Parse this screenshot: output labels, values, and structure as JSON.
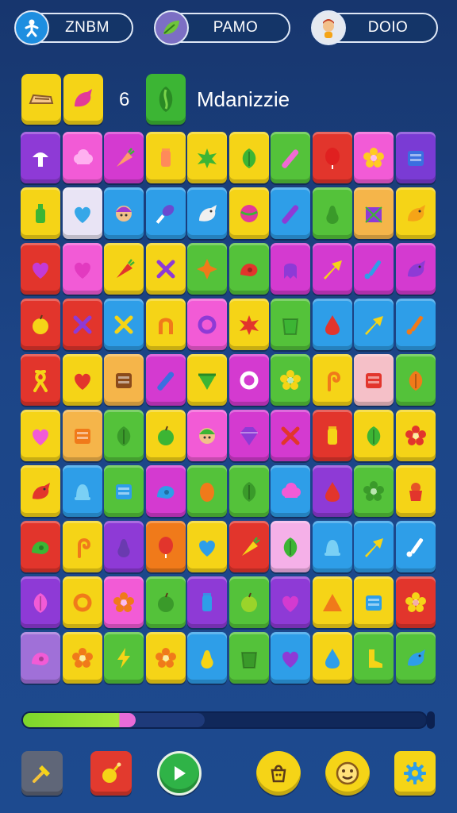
{
  "status_bar": {
    "stat1": {
      "value": "ZNBM",
      "icon": "running-figure-icon"
    },
    "stat2": {
      "value": "PAMO",
      "icon": "leaf-icon"
    },
    "stat3": {
      "value": "DOIO",
      "icon": "avatar-icon"
    }
  },
  "header": {
    "goals": [
      {
        "icon": "shoe-icon",
        "color": "#f5d417"
      },
      {
        "icon": "bird-icon",
        "color": "#f5d417"
      },
      {
        "icon": "leaf-icon",
        "color": "#3cb534"
      }
    ],
    "goal_count": "6",
    "level_title": "Mdanizzie"
  },
  "board": {
    "rows": [
      [
        {
          "c": "#8e3ad6",
          "g": "mushroom",
          "f": "#ffffff"
        },
        {
          "c": "#f25bd6",
          "g": "cloud",
          "f": "#ffb0f0"
        },
        {
          "c": "#d43ad0",
          "g": "carrot",
          "f": "#ff9b6a"
        },
        {
          "c": "#f5d417",
          "g": "jar",
          "f": "#ff8a5a"
        },
        {
          "c": "#f5d417",
          "g": "splat",
          "f": "#3cb534"
        },
        {
          "c": "#f5d417",
          "g": "leaf",
          "f": "#3cb534"
        },
        {
          "c": "#54c23a",
          "g": "stick",
          "f": "#f06ad4"
        },
        {
          "c": "#e2352c",
          "g": "balloon",
          "f": "#e02020"
        },
        {
          "c": "#f25bd6",
          "g": "flower",
          "f": "#ffcc22"
        },
        {
          "c": "#7a3bd4",
          "g": "box",
          "f": "#3b6fe0"
        }
      ],
      [
        {
          "c": "#f5d417",
          "g": "bottle",
          "f": "#3cb534"
        },
        {
          "c": "#e9e4f5",
          "g": "heart",
          "f": "#36a7e8"
        },
        {
          "c": "#2e9ee8",
          "g": "face",
          "f": "#a23ad0"
        },
        {
          "c": "#2e9ee8",
          "g": "drumstick",
          "f": "#6a4ad0"
        },
        {
          "c": "#2e9ee8",
          "g": "bird",
          "f": "#f0f0f0"
        },
        {
          "c": "#f5d417",
          "g": "ball",
          "f": "#e23a9a"
        },
        {
          "c": "#2e9ee8",
          "g": "stick",
          "f": "#8e3ad6"
        },
        {
          "c": "#54c23a",
          "g": "pear",
          "f": "#3a9a2a"
        },
        {
          "c": "#f5b54a",
          "g": "gift",
          "f": "#8e3ad6"
        },
        {
          "c": "#f5d417",
          "g": "bird",
          "f": "#f5a417"
        }
      ],
      [
        {
          "c": "#e2352c",
          "g": "heart",
          "f": "#c43ad6"
        },
        {
          "c": "#f25bd6",
          "g": "heart",
          "f": "#e23ac0"
        },
        {
          "c": "#f5d417",
          "g": "carrot",
          "f": "#e2352c"
        },
        {
          "c": "#f5d417",
          "g": "cross",
          "f": "#8e3ad6"
        },
        {
          "c": "#54c23a",
          "g": "star4",
          "f": "#f07a1a"
        },
        {
          "c": "#54c23a",
          "g": "snail",
          "f": "#e2352c"
        },
        {
          "c": "#d43ad0",
          "g": "ghost",
          "f": "#8e3ad6"
        },
        {
          "c": "#d43ad0",
          "g": "arrow",
          "f": "#f5d417"
        },
        {
          "c": "#d43ad0",
          "g": "brush",
          "f": "#2e9ee8"
        },
        {
          "c": "#d43ad0",
          "g": "bird",
          "f": "#8e3ad6"
        }
      ],
      [
        {
          "c": "#e2352c",
          "g": "apple",
          "f": "#f5d417"
        },
        {
          "c": "#e2352c",
          "g": "cross",
          "f": "#8e3ad6"
        },
        {
          "c": "#2e9ee8",
          "g": "cross",
          "f": "#f5d417"
        },
        {
          "c": "#f5d417",
          "g": "arch",
          "f": "#f07a1a"
        },
        {
          "c": "#f25bd6",
          "g": "ring",
          "f": "#8e3ad6"
        },
        {
          "c": "#f5d417",
          "g": "splat",
          "f": "#e2352c"
        },
        {
          "c": "#54c23a",
          "g": "cup",
          "f": "#3cb534"
        },
        {
          "c": "#2e9ee8",
          "g": "drop",
          "f": "#e2352c"
        },
        {
          "c": "#2e9ee8",
          "g": "arrow",
          "f": "#f5d417"
        },
        {
          "c": "#2e9ee8",
          "g": "brush",
          "f": "#f07a1a"
        }
      ],
      [
        {
          "c": "#e2352c",
          "g": "ribbon",
          "f": "#f5d417"
        },
        {
          "c": "#f5d417",
          "g": "heart",
          "f": "#e2352c"
        },
        {
          "c": "#f5b54a",
          "g": "box",
          "f": "#8a4a1a"
        },
        {
          "c": "#d43ad0",
          "g": "stick",
          "f": "#3b6fe0"
        },
        {
          "c": "#f5d417",
          "g": "shield",
          "f": "#3cb534"
        },
        {
          "c": "#d43ad0",
          "g": "ring",
          "f": "#ffffff"
        },
        {
          "c": "#54c23a",
          "g": "flower",
          "f": "#f5d417"
        },
        {
          "c": "#f5d417",
          "g": "hook",
          "f": "#f07a1a"
        },
        {
          "c": "#f5c0c8",
          "g": "box",
          "f": "#e2352c"
        },
        {
          "c": "#54c23a",
          "g": "leaf",
          "f": "#f07a1a"
        }
      ],
      [
        {
          "c": "#f5d417",
          "g": "heart",
          "f": "#f25bd6"
        },
        {
          "c": "#f5b54a",
          "g": "box",
          "f": "#f07a1a"
        },
        {
          "c": "#54c23a",
          "g": "leaf",
          "f": "#3a9a2a"
        },
        {
          "c": "#f5d417",
          "g": "apple",
          "f": "#3cb534"
        },
        {
          "c": "#f25bd6",
          "g": "face",
          "f": "#3cb534"
        },
        {
          "c": "#d43ad0",
          "g": "gem",
          "f": "#8e3ad6"
        },
        {
          "c": "#d43ad0",
          "g": "cross",
          "f": "#e2352c"
        },
        {
          "c": "#e2352c",
          "g": "jar",
          "f": "#f5d417"
        },
        {
          "c": "#f5d417",
          "g": "leaf",
          "f": "#3cb534"
        },
        {
          "c": "#f5d417",
          "g": "flower",
          "f": "#e2352c"
        }
      ],
      [
        {
          "c": "#f5d417",
          "g": "bird",
          "f": "#e2352c"
        },
        {
          "c": "#2e9ee8",
          "g": "bell",
          "f": "#7ad0f5"
        },
        {
          "c": "#54c23a",
          "g": "box",
          "f": "#2e9ee8"
        },
        {
          "c": "#d43ad0",
          "g": "snail",
          "f": "#2e9ee8"
        },
        {
          "c": "#54c23a",
          "g": "egg",
          "f": "#f07a1a"
        },
        {
          "c": "#54c23a",
          "g": "leaf",
          "f": "#3a9a2a"
        },
        {
          "c": "#2e9ee8",
          "g": "cloud",
          "f": "#f25bd6"
        },
        {
          "c": "#8e3ad6",
          "g": "drop",
          "f": "#e2352c"
        },
        {
          "c": "#54c23a",
          "g": "flower",
          "f": "#3a9a2a"
        },
        {
          "c": "#f5d417",
          "g": "pot",
          "f": "#e2352c"
        }
      ],
      [
        {
          "c": "#e2352c",
          "g": "snail",
          "f": "#3cb534"
        },
        {
          "c": "#f5d417",
          "g": "hook",
          "f": "#f07a1a"
        },
        {
          "c": "#8e3ad6",
          "g": "pear",
          "f": "#6a3ab0"
        },
        {
          "c": "#f07a1a",
          "g": "balloon",
          "f": "#e2352c"
        },
        {
          "c": "#f5d417",
          "g": "heart",
          "f": "#2e9ee8"
        },
        {
          "c": "#e2352c",
          "g": "carrot",
          "f": "#f5d417"
        },
        {
          "c": "#f5b0e8",
          "g": "leaf",
          "f": "#3cb534"
        },
        {
          "c": "#2e9ee8",
          "g": "bell",
          "f": "#7ad0f5"
        },
        {
          "c": "#2e9ee8",
          "g": "arrow",
          "f": "#f5d417"
        },
        {
          "c": "#2e9ee8",
          "g": "brush",
          "f": "#ffffff"
        }
      ],
      [
        {
          "c": "#8e3ad6",
          "g": "leaf",
          "f": "#f25bd6"
        },
        {
          "c": "#f5d417",
          "g": "ring",
          "f": "#f07a1a"
        },
        {
          "c": "#f25bd6",
          "g": "flower",
          "f": "#f07a1a"
        },
        {
          "c": "#54c23a",
          "g": "apple",
          "f": "#3a9a2a"
        },
        {
          "c": "#8e3ad6",
          "g": "jar",
          "f": "#2e9ee8"
        },
        {
          "c": "#54c23a",
          "g": "apple",
          "f": "#9ad42a"
        },
        {
          "c": "#8e3ad6",
          "g": "heart",
          "f": "#d43ad0"
        },
        {
          "c": "#f5d417",
          "g": "tri",
          "f": "#f07a1a"
        },
        {
          "c": "#f5d417",
          "g": "box",
          "f": "#2e9ee8"
        },
        {
          "c": "#e2352c",
          "g": "flower",
          "f": "#f5d417"
        }
      ],
      [
        {
          "c": "#a070d8",
          "g": "snail",
          "f": "#f25bd6"
        },
        {
          "c": "#f5d417",
          "g": "flower",
          "f": "#f07a1a"
        },
        {
          "c": "#54c23a",
          "g": "bolt",
          "f": "#f5d417"
        },
        {
          "c": "#f5d417",
          "g": "flower",
          "f": "#f07a1a"
        },
        {
          "c": "#2e9ee8",
          "g": "pear",
          "f": "#f5d417"
        },
        {
          "c": "#54c23a",
          "g": "cup",
          "f": "#3a9a2a"
        },
        {
          "c": "#2e9ee8",
          "g": "heart",
          "f": "#8e3ad6"
        },
        {
          "c": "#f5d417",
          "g": "drop",
          "f": "#2e9ee8"
        },
        {
          "c": "#54c23a",
          "g": "boot",
          "f": "#f5d417"
        },
        {
          "c": "#54c23a",
          "g": "bird",
          "f": "#2e9ee8"
        }
      ]
    ]
  },
  "progress": {
    "fraction": 0.28,
    "secondary_fraction": 0.45
  },
  "toolbar": [
    {
      "name": "hammer-button",
      "icon": "hammer-icon"
    },
    {
      "name": "bomb-button",
      "icon": "bomb-icon"
    },
    {
      "name": "play-button",
      "icon": "play-icon"
    },
    {
      "name": "shop-button",
      "icon": "shop-icon"
    },
    {
      "name": "profile-button",
      "icon": "smiley-icon"
    },
    {
      "name": "settings-button",
      "icon": "gear-icon"
    }
  ]
}
